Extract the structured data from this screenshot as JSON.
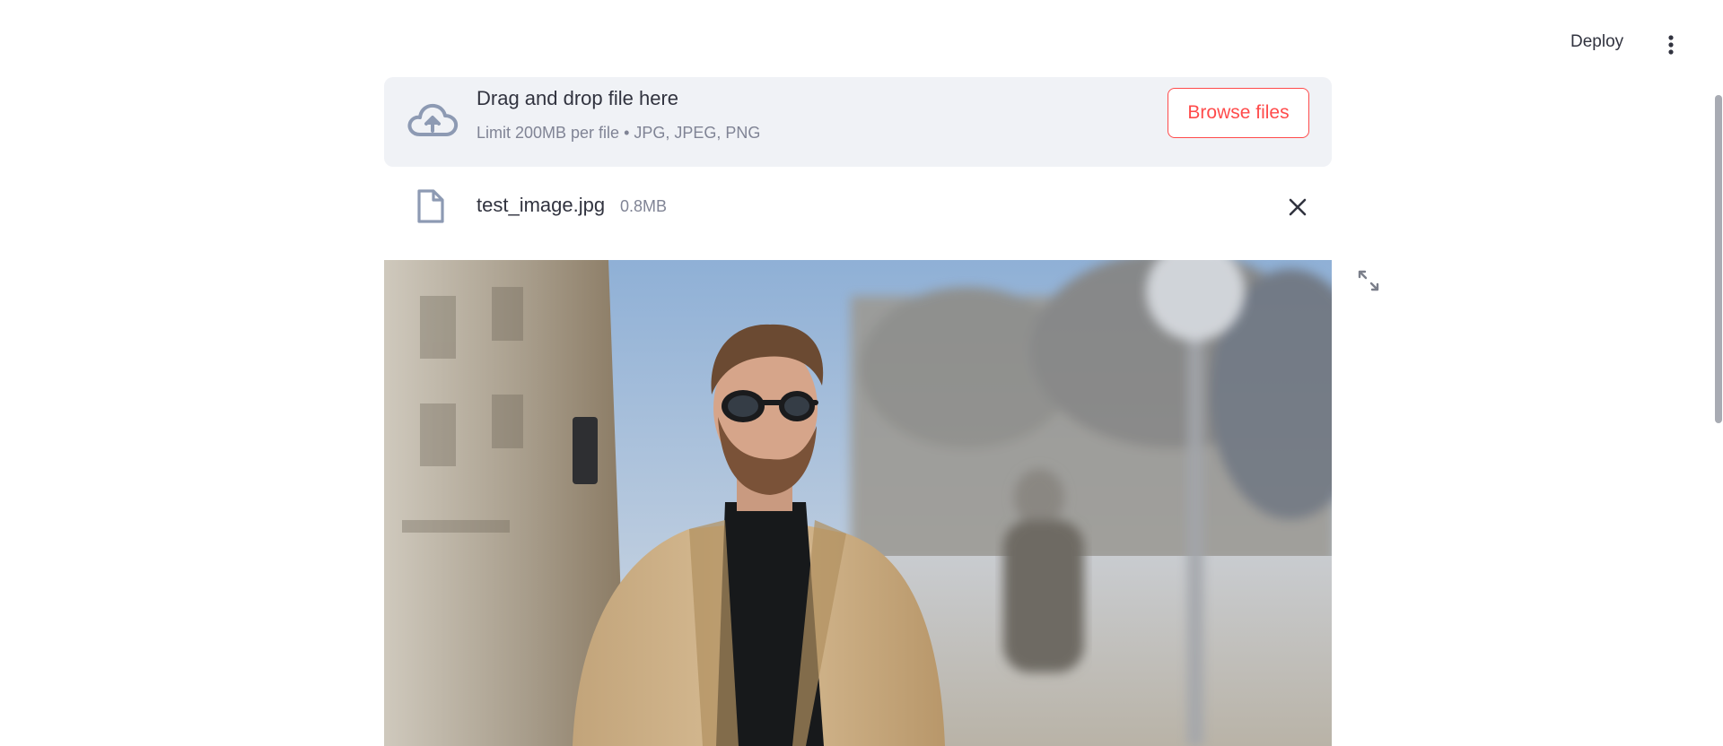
{
  "header": {
    "deploy_label": "Deploy",
    "menu_icon": "kebab-menu-icon"
  },
  "uploader": {
    "icon": "cloud-upload-icon",
    "title": "Drag and drop file here",
    "subtitle": "Limit 200MB per file • JPG, JPEG, PNG",
    "browse_label": "Browse files"
  },
  "uploaded_file": {
    "icon": "file-icon",
    "name": "test_image.jpg",
    "size": "0.8MB",
    "remove_icon": "close-icon"
  },
  "image": {
    "expand_icon": "fullscreen-expand-icon"
  },
  "colors": {
    "accent": "#ff4b4b",
    "dropzone_bg": "#f0f2f6",
    "text": "#31333f",
    "muted": "#808495",
    "icon": "#8d9ab3"
  }
}
